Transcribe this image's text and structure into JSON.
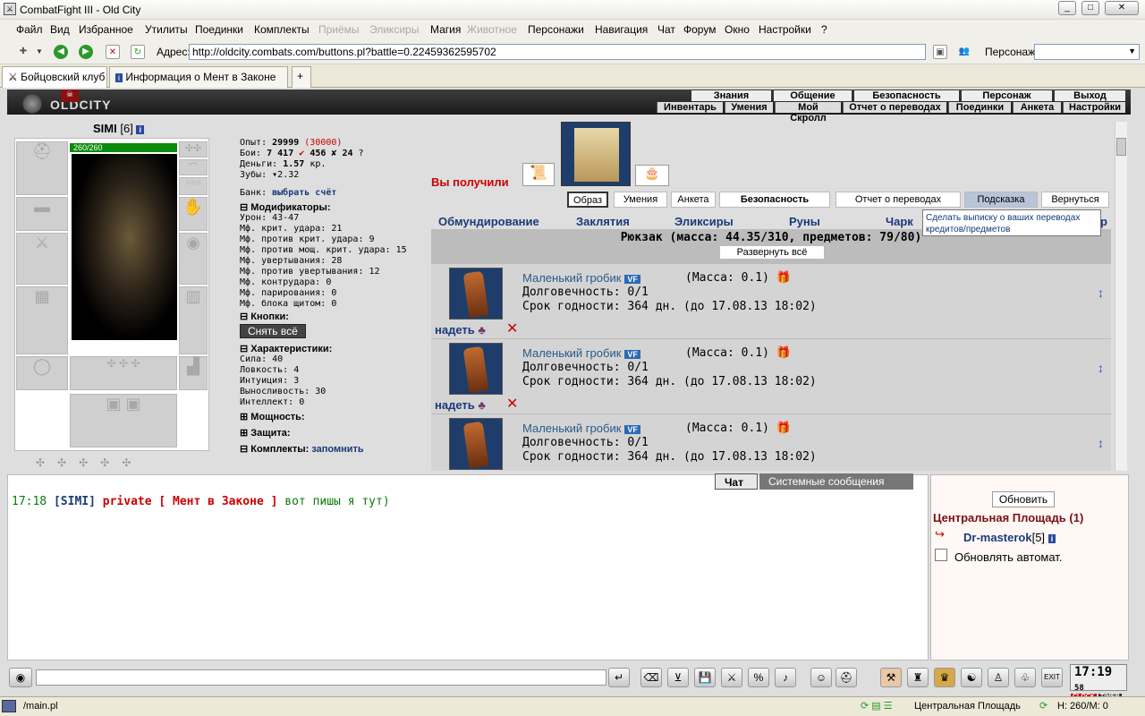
{
  "window": {
    "title": "CombatFight III - Old City",
    "minimize": "_",
    "maximize": "□",
    "close": "✕"
  },
  "menu": [
    "Файл",
    "Вид",
    "Избранное",
    "Утилиты",
    "Поединки",
    "Комплекты",
    "Приёмы",
    "Эликсиры",
    "Магия",
    "Животное",
    "Персонажи",
    "Навигация",
    "Чат",
    "Форум",
    "Окно",
    "Настройки",
    "?"
  ],
  "address": {
    "label": "Адрес:",
    "url": "http://oldcity.combats.com/buttons.pl?battle=0.22459362595702",
    "persona_label": "Персонаж:"
  },
  "tabs": [
    "Бойцовский клуб",
    "Информация о Мент в Законе"
  ],
  "header": {
    "logo": "OLDCITY",
    "nav_top": [
      "Знания",
      "Общение",
      "Безопасность",
      "Персонаж",
      "Выход"
    ],
    "nav_bottom": [
      "Инвентарь",
      "Умения",
      "Мой Скролл",
      "Отчет о переводах",
      "Поединки",
      "Анкета",
      "Настройки"
    ]
  },
  "character": {
    "name": "SIMI",
    "level": "[6]",
    "hp": "260/260",
    "exp_label": "Опыт:",
    "exp": "29999",
    "exp_next": "(30000)",
    "fights_label": "Бои:",
    "wins": "7 417",
    "losses": "456",
    "draws": "24",
    "money_label": "Деньги:",
    "money": "1.57",
    "money_unit": "кр.",
    "teeth_label": "Зубы:",
    "teeth": "2.32",
    "bank_label": "Банк:",
    "bank_link": "выбрать счёт",
    "modifiers_title": "Модификаторы:",
    "modifiers": [
      "Урон: 43-47",
      "Мф. крит. удара: 21",
      "Мф. против крит. удара: 9",
      "Мф. против мощ. крит. удара: 15",
      "Мф. увертывания: 28",
      "Мф. против увертывания: 12",
      "Мф. контрудара: 0",
      "Мф. парирования: 0",
      "Мф. блока щитом: 0"
    ],
    "buttons_title": "Кнопки:",
    "remove_all": "Снять всё",
    "stats_title": "Характеристики:",
    "stats": [
      "Сила: 40",
      "Ловкость: 4",
      "Интуиция: 3",
      "Выносливость: 30",
      "Интеллект: 0"
    ],
    "power_title": "Мощность:",
    "defense_title": "Защита:",
    "sets_title": "Комплекты:",
    "sets_link": "запомнить"
  },
  "received": {
    "label": "Вы получили"
  },
  "topbuttons": [
    "Образ",
    "Умения",
    "Анкета",
    "Безопасность",
    "Отчет о переводах",
    "Подсказка",
    "Вернуться"
  ],
  "inventory": {
    "tabs": [
      "Обмундирование",
      "Заклятия",
      "Эликсиры",
      "Руны",
      "Чарк"
    ],
    "tab_tail": "р",
    "backpack": "Рюкзак (масса: 44.35/310, предметов: 79/80)",
    "expand": "Развернуть всё",
    "tooltip": "Сделать выписку о ваших переводах кредитов/предметов",
    "items": [
      {
        "name": "Маленький гробик",
        "badge": "VF",
        "mass": "(Масса: 0.1)",
        "durability": "Долговечность: 0/1",
        "expiry": "Срок годности: 364 дн. (до 17.08.13 18:02)",
        "action": "надеть"
      },
      {
        "name": "Маленький гробик",
        "badge": "VF",
        "mass": "(Масса: 0.1)",
        "durability": "Долговечность: 0/1",
        "expiry": "Срок годности: 364 дн. (до 17.08.13 18:02)",
        "action": "надеть"
      },
      {
        "name": "Маленький гробик",
        "badge": "VF",
        "mass": "(Масса: 0.1)",
        "durability": "Долговечность: 0/1",
        "expiry": "Срок годности: 364 дн. (до 17.08.13 18:02)",
        "action": "надеть"
      }
    ]
  },
  "chat": {
    "tab_chat": "Чат",
    "tab_system": "Системные сообщения",
    "time": "17:18",
    "sender": "[SIMI]",
    "private": "private [ Мент в Законе ]",
    "text": "вот пишы я тут)"
  },
  "online": {
    "refresh": "Обновить",
    "location": "Центральная Площадь (1)",
    "user": "Dr-masterok",
    "user_level": "[5]",
    "auto": "Обновлять автомат."
  },
  "clock": {
    "time": "17:19",
    "sec": "58",
    "label1": "CLOCK",
    "label2": "TIMER",
    "exit": "EXIT"
  },
  "status": {
    "path": "/main.pl",
    "location": "Центральная Площадь",
    "hp": "H: 260/M: 0"
  },
  "colors": {
    "accent_red": "#cc0000",
    "link_blue": "#1a3a7a",
    "hp_green": "#0a8a0a"
  }
}
